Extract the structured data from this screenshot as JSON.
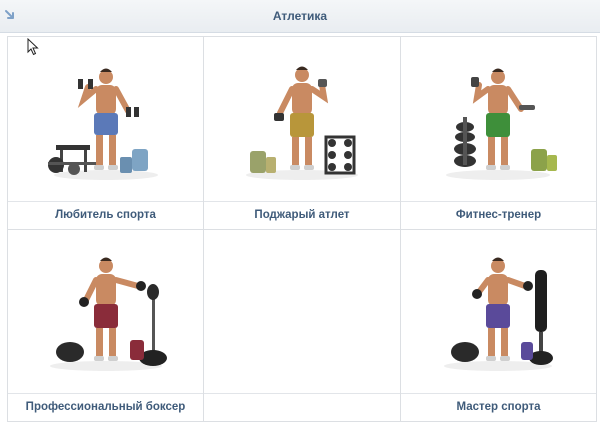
{
  "header": {
    "title": "Атлетика",
    "back_icon": "back-arrow-icon"
  },
  "achievements": [
    {
      "label": "Любитель спорта",
      "shorts_color": "#5b79b8",
      "prop": "weight-bench"
    },
    {
      "label": "Поджарый атлет",
      "shorts_color": "#b8963a",
      "prop": "dumbbell-rack"
    },
    {
      "label": "Фитнес-тренер",
      "shorts_color": "#3e8f3a",
      "prop": "weight-plates"
    },
    {
      "label": "Профессиональный боксер",
      "shorts_color": "#8a2c3a",
      "prop": "speed-bag"
    },
    {
      "label": "",
      "shorts_color": "",
      "prop": ""
    },
    {
      "label": "Мастер спорта",
      "shorts_color": "#5a4a9a",
      "prop": "heavy-bag"
    }
  ],
  "colors": {
    "title_text": "#3f5b7a",
    "grid_border": "#dcdfe3",
    "skin": "#c98a62"
  }
}
